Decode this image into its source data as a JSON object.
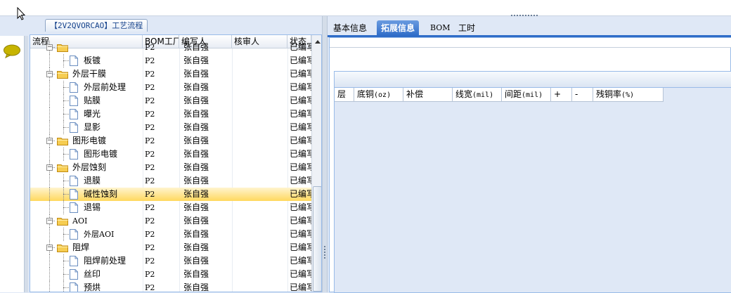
{
  "window": {
    "title": "【2V2QVORCAO】工艺流程"
  },
  "tree": {
    "columns": [
      "流程",
      "BOM工厂",
      "编写人",
      "核审人",
      "状态"
    ],
    "rows": [
      {
        "name": "",
        "level": 1,
        "type": "folder",
        "bom": "P2",
        "writer": "张自强",
        "reviewer": "",
        "status": "已编写"
      },
      {
        "name": "板镀",
        "level": 2,
        "type": "doc",
        "bom": "P2",
        "writer": "张自强",
        "reviewer": "",
        "status": "已编写"
      },
      {
        "name": "外层干膜",
        "level": 1,
        "type": "folder",
        "bom": "P2",
        "writer": "张自强",
        "reviewer": "",
        "status": "已编写"
      },
      {
        "name": "外层前处理",
        "level": 2,
        "type": "doc",
        "bom": "P2",
        "writer": "张自强",
        "reviewer": "",
        "status": "已编写"
      },
      {
        "name": "贴膜",
        "level": 2,
        "type": "doc",
        "bom": "P2",
        "writer": "张自强",
        "reviewer": "",
        "status": "已编写"
      },
      {
        "name": "曝光",
        "level": 2,
        "type": "doc",
        "bom": "P2",
        "writer": "张自强",
        "reviewer": "",
        "status": "已编写"
      },
      {
        "name": "显影",
        "level": 2,
        "type": "doc",
        "bom": "P2",
        "writer": "张自强",
        "reviewer": "",
        "status": "已编写"
      },
      {
        "name": "图形电镀",
        "level": 1,
        "type": "folder",
        "bom": "P2",
        "writer": "张自强",
        "reviewer": "",
        "status": "已编写"
      },
      {
        "name": "图形电镀",
        "level": 2,
        "type": "doc",
        "bom": "P2",
        "writer": "张自强",
        "reviewer": "",
        "status": "已编写"
      },
      {
        "name": "外层蚀刻",
        "level": 1,
        "type": "folder",
        "bom": "P2",
        "writer": "张自强",
        "reviewer": "",
        "status": "已编写"
      },
      {
        "name": "退膜",
        "level": 2,
        "type": "doc",
        "bom": "P2",
        "writer": "张自强",
        "reviewer": "",
        "status": "已编写"
      },
      {
        "name": "碱性蚀刻",
        "level": 2,
        "type": "doc",
        "bom": "P2",
        "writer": "张自强",
        "reviewer": "",
        "status": "已编写",
        "selected": true
      },
      {
        "name": "退锡",
        "level": 2,
        "type": "doc",
        "bom": "P2",
        "writer": "张自强",
        "reviewer": "",
        "status": "已编写"
      },
      {
        "name": "AOI",
        "level": 1,
        "type": "folder",
        "bom": "P2",
        "writer": "张自强",
        "reviewer": "",
        "status": "已编写"
      },
      {
        "name": "外层AOI",
        "level": 2,
        "type": "doc",
        "bom": "P2",
        "writer": "张自强",
        "reviewer": "",
        "status": "已编写"
      },
      {
        "name": "阻焊",
        "level": 1,
        "type": "folder",
        "bom": "P2",
        "writer": "张自强",
        "reviewer": "",
        "status": "已编写"
      },
      {
        "name": "阻焊前处理",
        "level": 2,
        "type": "doc",
        "bom": "P2",
        "writer": "张自强",
        "reviewer": "",
        "status": "已编写"
      },
      {
        "name": "丝印",
        "level": 2,
        "type": "doc",
        "bom": "P2",
        "writer": "张自强",
        "reviewer": "",
        "status": "已编写"
      },
      {
        "name": "预烘",
        "level": 2,
        "type": "doc",
        "bom": "P2",
        "writer": "张自强",
        "reviewer": "",
        "status": "已编写"
      }
    ]
  },
  "tabs": [
    {
      "label": "基本信息",
      "active": false
    },
    {
      "label": "拓展信息",
      "active": true
    },
    {
      "label": "BOM",
      "active": false
    },
    {
      "label": "工时",
      "active": false
    }
  ],
  "grid": {
    "columns": [
      {
        "label": "层",
        "unit": ""
      },
      {
        "label": "底铜",
        "unit": "(oz)"
      },
      {
        "label": "补偿",
        "unit": ""
      },
      {
        "label": "线宽",
        "unit": "(mil)"
      },
      {
        "label": "间距",
        "unit": "(mil)"
      },
      {
        "label": "+",
        "unit": ""
      },
      {
        "label": "-",
        "unit": ""
      },
      {
        "label": "残铜率",
        "unit": "(%)"
      }
    ]
  },
  "colors": {
    "accent": "#2e6cc8",
    "selection": "#ffd85d",
    "border": "#99bbe8"
  },
  "icons": [
    "cursor-icon",
    "chat-bubble-icon",
    "folder-icon",
    "document-icon",
    "scroll-up-arrow-icon"
  ]
}
